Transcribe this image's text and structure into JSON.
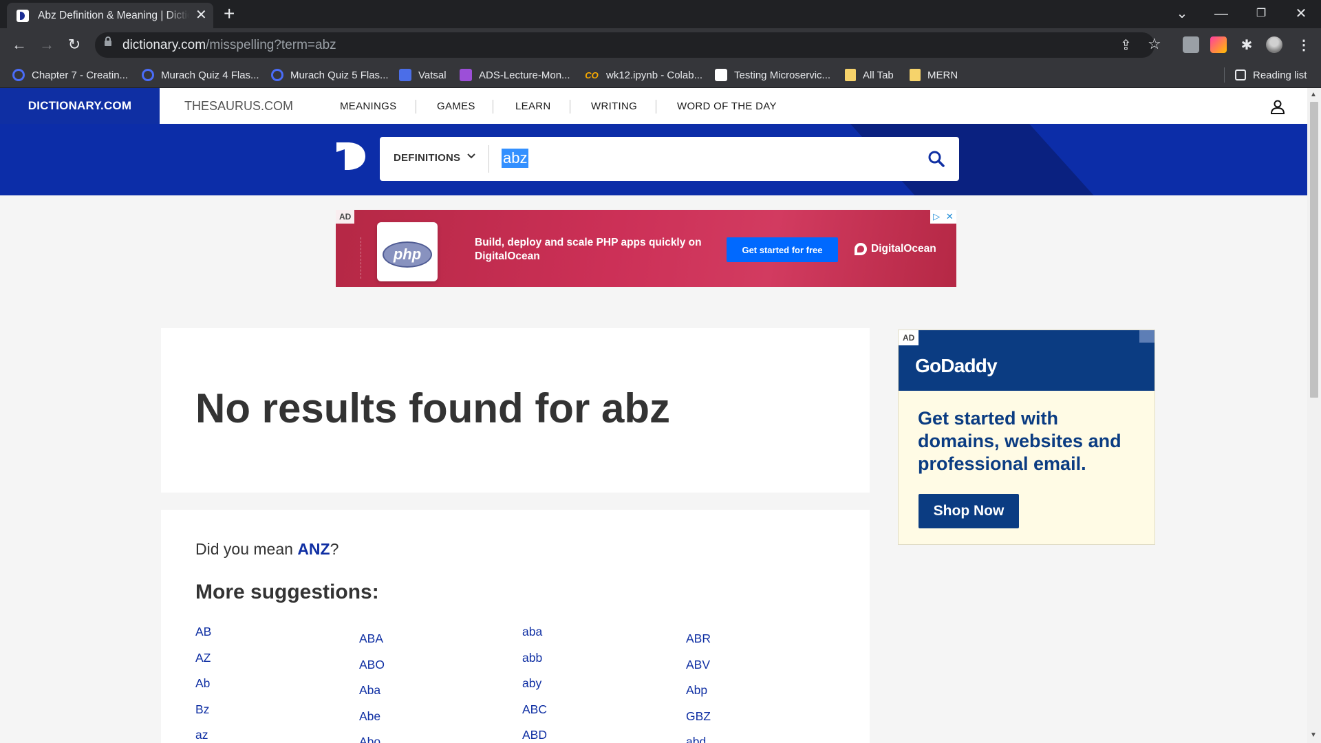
{
  "browser": {
    "tab_title": "Abz Definition & Meaning | Dictionary.com",
    "tab_close": "✕",
    "new_tab": "+",
    "url_host": "dictionary.com",
    "url_path": "/misspelling?term=abz",
    "bookmarks": [
      "Chapter 7 - Creatin...",
      "Murach Quiz 4 Flas...",
      "Murach Quiz 5 Flas...",
      "Vatsal",
      "ADS-Lecture-Mon...",
      "wk12.ipynb - Colab...",
      "Testing Microservic...",
      "All Tab",
      "MERN"
    ],
    "reading_list": "Reading list",
    "icons": {
      "back": "back-arrow-icon",
      "forward": "forward-arrow-icon",
      "reload": "reload-icon",
      "share": "share-icon",
      "star": "bookmark-star-icon",
      "extensions": "puzzle-icon",
      "menu": "kebab-menu-icon"
    }
  },
  "site": {
    "brand": "DICTIONARY.COM",
    "thesaurus": "THESAURUS.COM",
    "nav": [
      "MEANINGS",
      "GAMES",
      "LEARN",
      "WRITING",
      "WORD OF THE DAY"
    ],
    "search": {
      "category": "DEFINITIONS",
      "value": "abz"
    }
  },
  "ad_banner": {
    "badge": "AD",
    "logo_text": "php",
    "text": "Build, deploy and scale PHP apps quickly on DigitalOcean",
    "cta": "Get started for free",
    "brand": "DigitalOcean"
  },
  "results": {
    "no_results_prefix": "No results found for ",
    "term": "abz",
    "did_you_mean_prefix": "Did you mean ",
    "did_you_mean_term": "ANZ",
    "did_you_mean_suffix": "?",
    "more_suggestions": "More suggestions:",
    "columns": [
      [
        "AB",
        "AZ",
        "Ab",
        "Bz",
        "az"
      ],
      [
        "ABA",
        "ABO",
        "Aba",
        "Abe",
        "Abo"
      ],
      [
        "aba",
        "abb",
        "aby",
        "ABC",
        "ABD"
      ],
      [
        "ABR",
        "ABV",
        "Abp",
        "GBZ",
        "abd"
      ]
    ]
  },
  "ad_side": {
    "badge": "AD",
    "brand": "GoDaddy",
    "headline": "Get started with domains, websites and professional email.",
    "cta": "Shop Now"
  },
  "colors": {
    "brand_blue": "#0f2fa3",
    "search_band": "#0c2da8",
    "selection": "#3390ff",
    "godaddy_blue": "#0b3c82"
  }
}
